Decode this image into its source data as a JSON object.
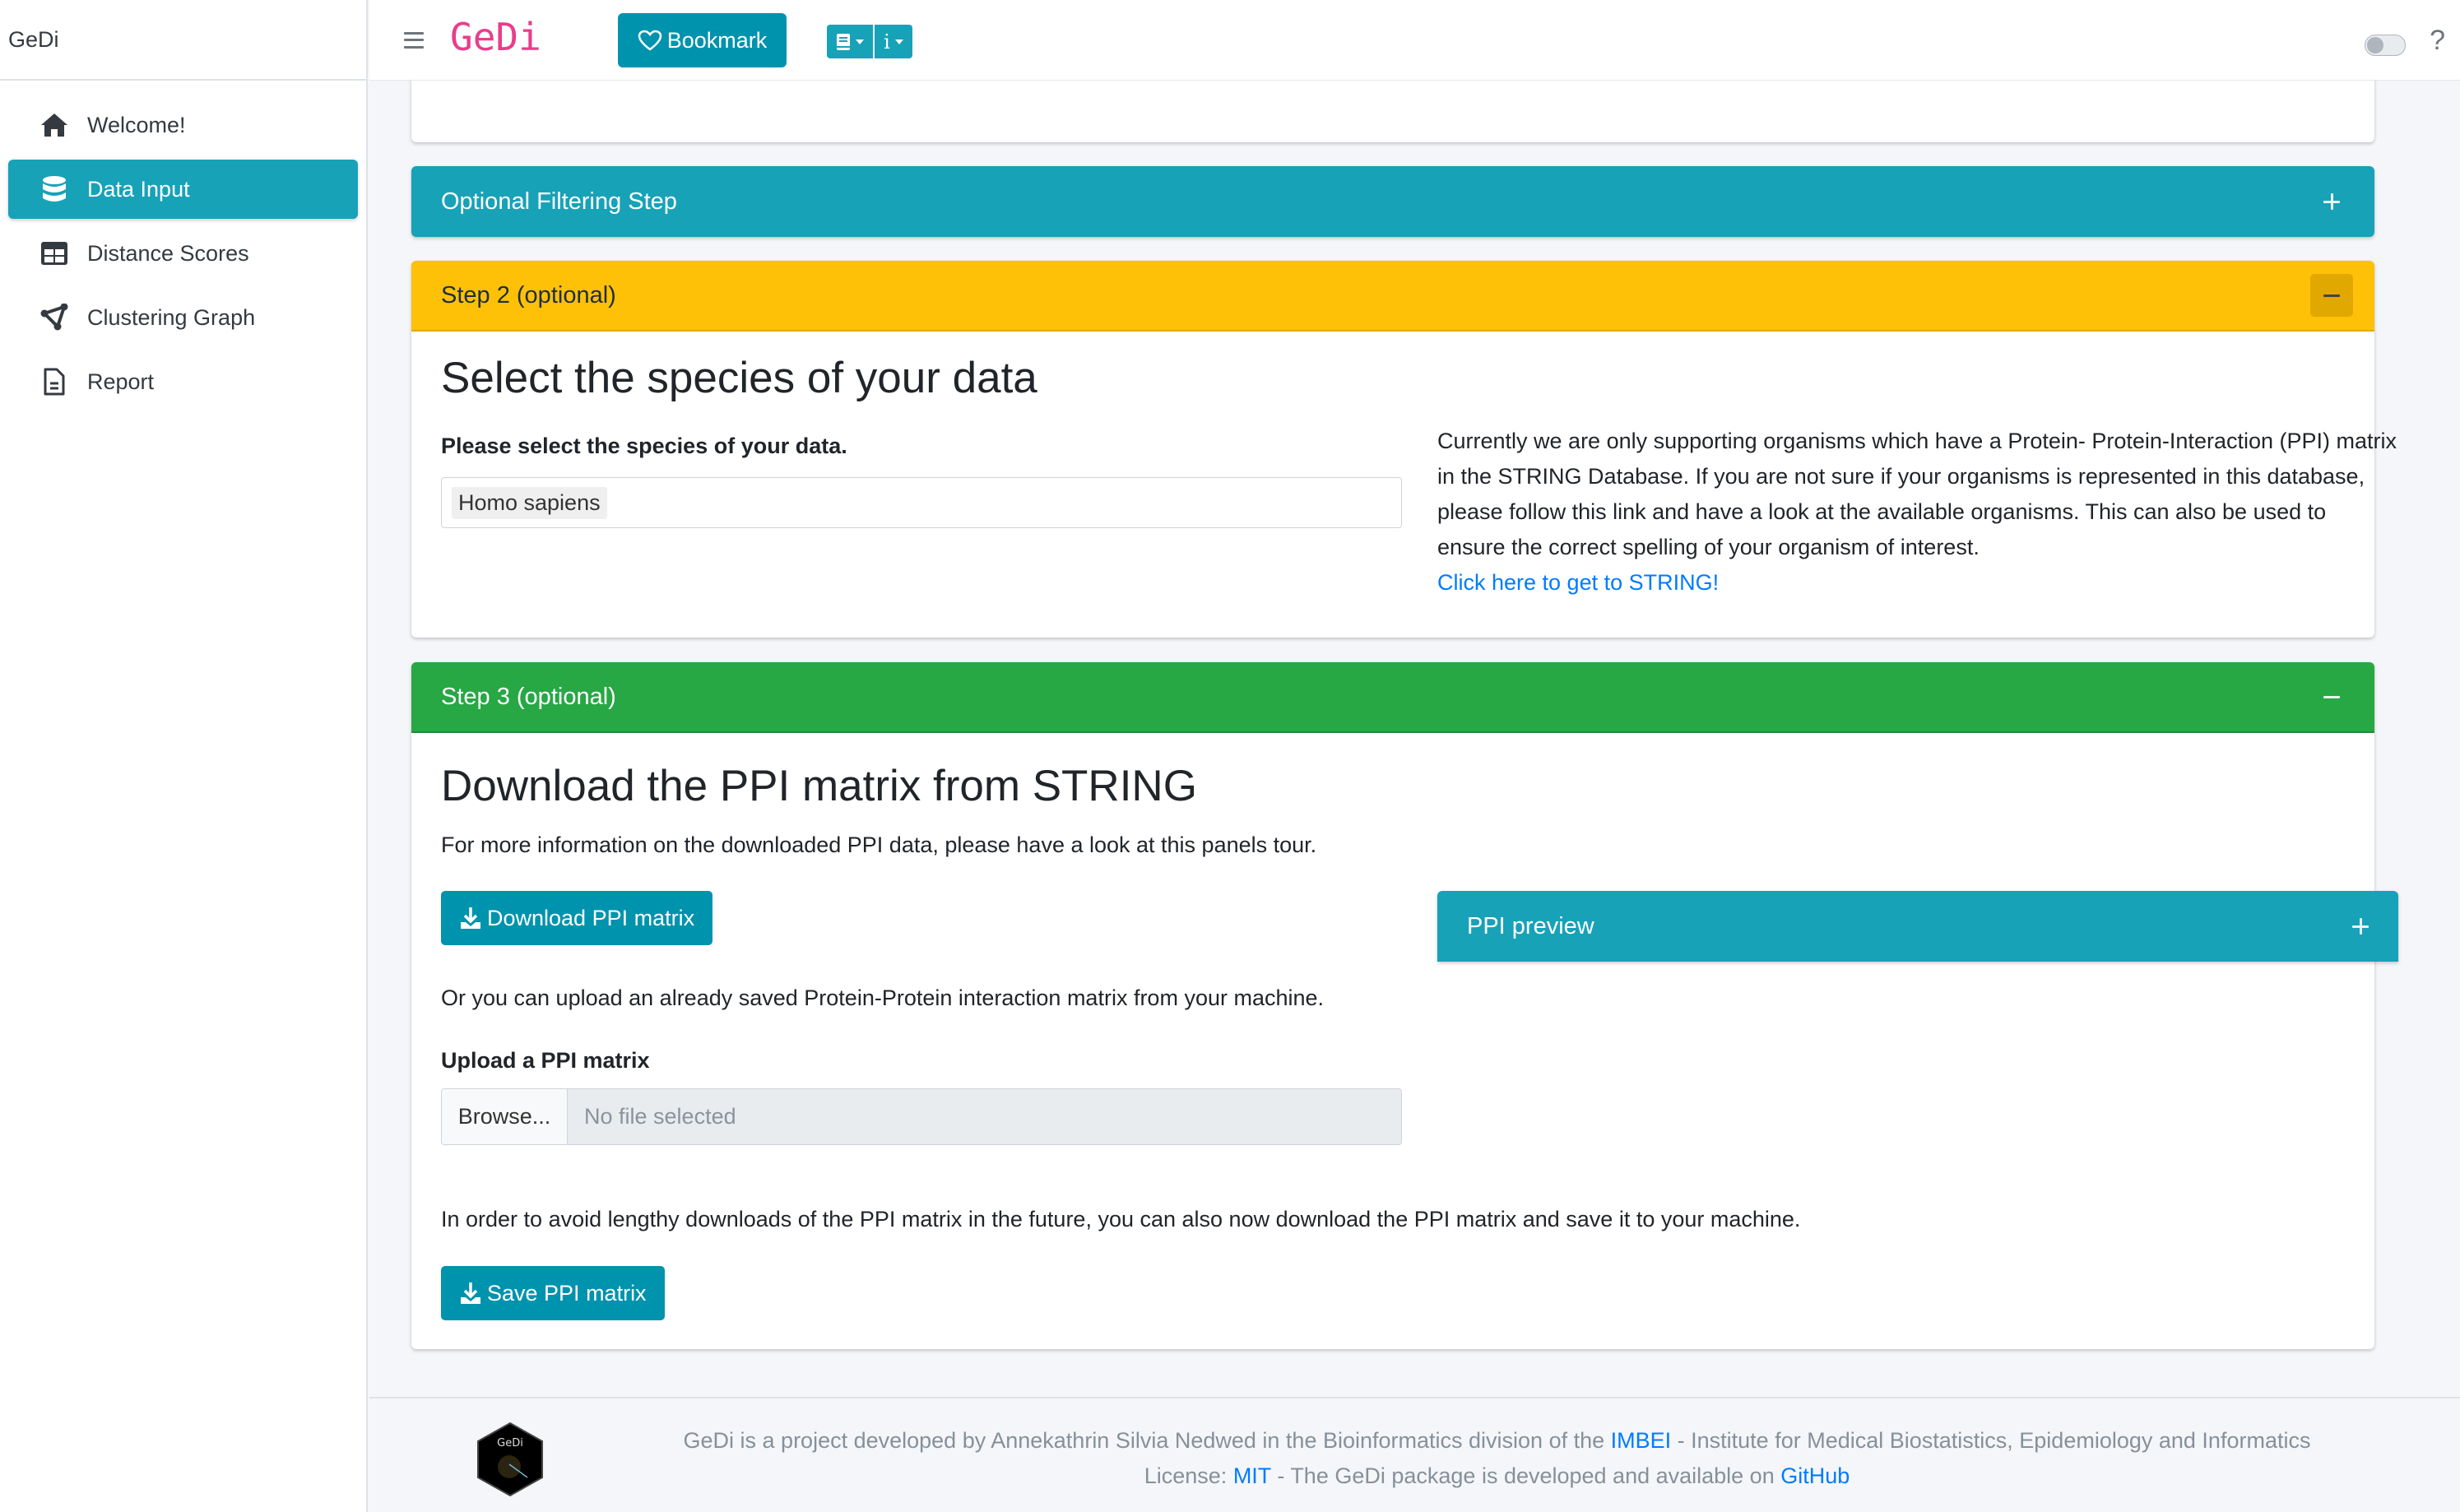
{
  "sidebar": {
    "brand": "GeDi",
    "items": [
      {
        "label": "Welcome!",
        "icon": "home-icon",
        "active": false
      },
      {
        "label": "Data Input",
        "icon": "database-icon",
        "active": true
      },
      {
        "label": "Distance Scores",
        "icon": "table-icon",
        "active": false
      },
      {
        "label": "Clustering Graph",
        "icon": "graph-icon",
        "active": false
      },
      {
        "label": "Report",
        "icon": "file-icon",
        "active": false
      }
    ]
  },
  "header": {
    "app_title": "GeDi",
    "bookmark_label": "Bookmark",
    "dropdowns": [
      {
        "icon": "book-icon"
      },
      {
        "icon": "info-icon",
        "label": "i"
      }
    ],
    "help_label": "?",
    "toggle_on": false
  },
  "colors": {
    "info": "#17a2b8",
    "primary_button": "#0093ad",
    "warning": "#ffc107",
    "success": "#28a745",
    "title_pink": "#e83e8c",
    "link": "#007bff"
  },
  "filtering_card": {
    "title": "Optional Filtering Step",
    "collapsed": true
  },
  "step2": {
    "header": "Step 2 (optional)",
    "title": "Select the species of your data",
    "select_label": "Please select the species of your data.",
    "selected_species": "Homo sapiens",
    "info_text": "Currently we are only supporting organisms which have a Protein- Protein-Interaction (PPI) matrix in the STRING Database. If you are not sure if your organisms is represented in this database, please follow this link and have a look at the available organisms. This can also be used to ensure the correct spelling of your organism of interest.",
    "string_link": "Click here to get to STRING!"
  },
  "step3": {
    "header": "Step 3 (optional)",
    "title": "Download the PPI matrix from STRING",
    "info": "For more information on the downloaded PPI data, please have a look at this panels tour.",
    "download_label": "Download PPI matrix",
    "ppi_preview_title": "PPI preview",
    "upload_text": "Or you can upload an already saved Protein-Protein interaction matrix from your machine.",
    "upload_label": "Upload a PPI matrix",
    "browse_label": "Browse...",
    "file_placeholder": "No file selected",
    "save_text": "In order to avoid lengthy downloads of the PPI matrix in the future, you can also now download the PPI matrix and save it to your machine.",
    "save_label": "Save PPI matrix"
  },
  "footer": {
    "logo_text": "GeDi",
    "line1_prefix": "GeDi is a project developed by Annekathrin Silvia Nedwed in the Bioinformatics division of the ",
    "line1_link": "IMBEI",
    "line1_suffix": " - Institute for Medical Biostatistics, Epidemiology and Informatics",
    "line2_prefix": "License: ",
    "line2_link1": "MIT",
    "line2_middle": " - The GeDi package is developed and available on ",
    "line2_link2": "GitHub"
  }
}
